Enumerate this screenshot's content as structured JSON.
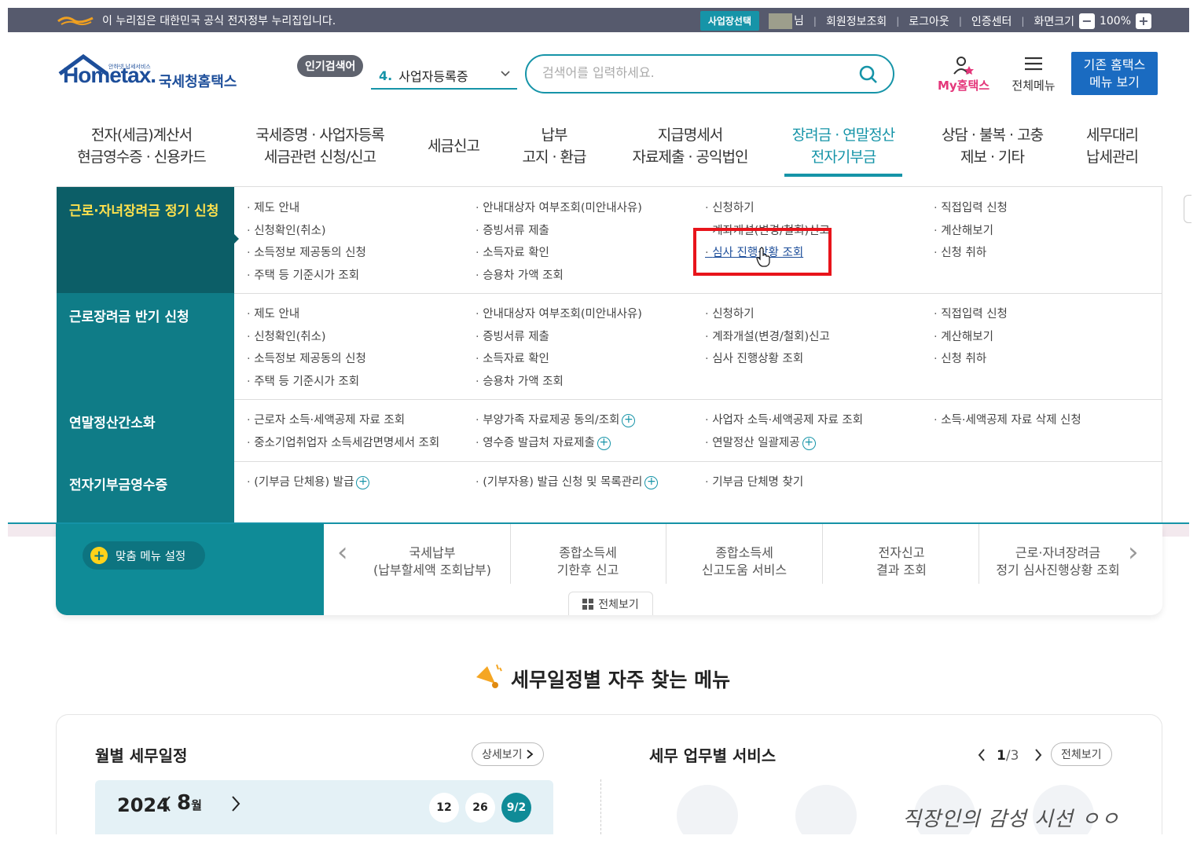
{
  "topbar": {
    "gov_text": "이 누리집은 대한민국 공식 전자정부 누리집입니다.",
    "biz_select": "사업장선택",
    "user_suffix": "님",
    "member_info": "회원정보조회",
    "logout": "로그아웃",
    "cert_center": "인증센터",
    "screen_size": "화면크기",
    "zoom": "100%",
    "zoom_out": "−",
    "zoom_in": "+"
  },
  "header": {
    "logo_brand": "Hometax.",
    "logo_ko": "국세청홈택스",
    "logo_tiny": "안하넷 납세서비스",
    "popular_badge": "인기검색어",
    "popular_num": "4.",
    "popular_term": "사업자등록증",
    "search_placeholder": "검색어를 입력하세요.",
    "my_hometax": "My홈택스",
    "all_menu": "전체메뉴",
    "old_menu_line1": "기존 홈택스",
    "old_menu_line2": "메뉴 보기"
  },
  "gnb": [
    {
      "l1": "전자(세금)계산서",
      "l2": "현금영수증 · 신용카드"
    },
    {
      "l1": "국세증명 · 사업자등록",
      "l2": "세금관련 신청/신고"
    },
    {
      "l1": "세금신고",
      "l2": ""
    },
    {
      "l1": "납부",
      "l2": "고지 · 환급"
    },
    {
      "l1": "지급명세서",
      "l2": "자료제출 · 공익법인"
    },
    {
      "l1": "장려금 · 연말정산",
      "l2": "전자기부금"
    },
    {
      "l1": "상담 · 불복 · 고충",
      "l2": "제보 · 기타"
    },
    {
      "l1": "세무대리",
      "l2": "납세관리"
    }
  ],
  "mega": {
    "categories": [
      "근로·자녀장려금 정기 신청",
      "근로장려금 반기 신청",
      "연말정산간소화",
      "전자기부금영수증"
    ],
    "sec1": {
      "c1": [
        "제도 안내",
        "신청확인(취소)",
        "소득정보 제공동의 신청",
        "주택 등 기준시가 조회"
      ],
      "c2": [
        "안내대상자 여부조회(미안내사유)",
        "증빙서류 제출",
        "소득자료 확인",
        "승용차 가액 조회"
      ],
      "c3": [
        "신청하기",
        "계좌개설(변경/철회)신고",
        "심사 진행상황 조회"
      ],
      "c4": [
        "직접입력 신청",
        "계산해보기",
        "신청 취하"
      ]
    },
    "sec2": {
      "c1": [
        "제도 안내",
        "신청확인(취소)",
        "소득정보 제공동의 신청",
        "주택 등 기준시가 조회"
      ],
      "c2": [
        "안내대상자 여부조회(미안내사유)",
        "증빙서류 제출",
        "소득자료 확인",
        "승용차 가액 조회"
      ],
      "c3": [
        "신청하기",
        "계좌개설(변경/철회)신고",
        "심사 진행상황 조회"
      ],
      "c4": [
        "직접입력 신청",
        "계산해보기",
        "신청 취하"
      ]
    },
    "sec3": {
      "c1": [
        "근로자 소득·세액공제 자료 조회",
        "중소기업취업자 소득세감면명세서 조회"
      ],
      "c2": [
        "부양가족 자료제공 동의/조회",
        "영수증 발급처 자료제출"
      ],
      "c3": [
        "사업자 소득·세액공제 자료 조회",
        "연말정산 일괄제공"
      ],
      "c4": [
        "소득·세액공제 자료 삭제 신청"
      ]
    },
    "sec4": {
      "c1": [
        "(기부금 단체용) 발급"
      ],
      "c2": [
        "(기부자용) 발급 신청 및 목록관리"
      ],
      "c3": [
        "기부금 단체명 찾기"
      ]
    },
    "plus": "+"
  },
  "quick": {
    "custom_menu": "맞춤 메뉴 설정",
    "custom_plus": "+",
    "prev": "‹",
    "next": "›",
    "items": [
      {
        "l1": "국세납부",
        "l2": "(납부할세액 조회납부)"
      },
      {
        "l1": "종합소득세",
        "l2": "기한후 신고"
      },
      {
        "l1": "종합소득세",
        "l2": "신고도움 서비스"
      },
      {
        "l1": "전자신고",
        "l2": "결과 조회"
      },
      {
        "l1": "근로·자녀장려금",
        "l2": "정기 심사진행상황 조회"
      }
    ],
    "view_all": "전체보기"
  },
  "schedule": {
    "section_title": "세무일정별 자주 찾는 메뉴",
    "monthly_title": "월별 세무일정",
    "detail_btn": "상세보기",
    "year": "2024",
    "month": "8",
    "month_unit": "월",
    "days": [
      "12",
      "26",
      "9/2"
    ],
    "service_title": "세무 업무별 서비스",
    "page_cur": "1",
    "page_total": "/3",
    "service_all": "전체보기"
  },
  "watermark": "직장인의 감성 시선 ㅇㅇ",
  "colors": {
    "teal": "#1694a8",
    "dark_teal": "#0c5e67",
    "topbar": "#565a6d",
    "highlight_box": "#e8141b"
  }
}
